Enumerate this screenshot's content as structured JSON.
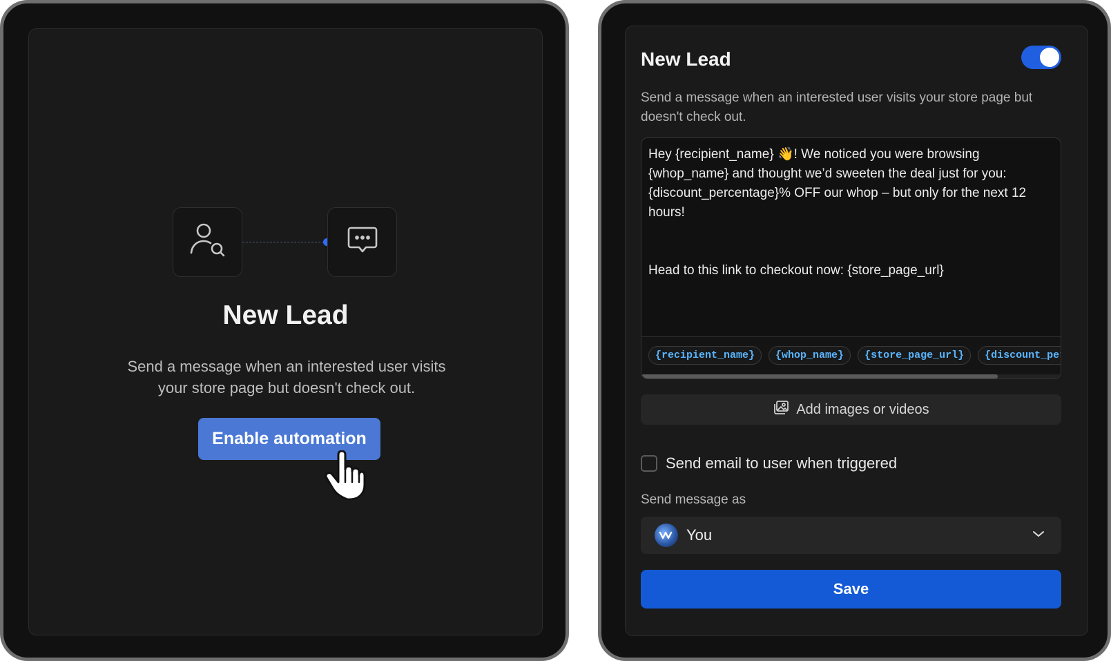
{
  "left": {
    "title": "New Lead",
    "description": "Send a message when an interested user visits your store page but doesn't check out.",
    "enable_button": "Enable automation"
  },
  "right": {
    "title": "New Lead",
    "toggle_on": true,
    "description": "Send a message when an interested user visits your store page but doesn't check out.",
    "message": "Hey {recipient_name} 👋! We noticed you were browsing {whop_name} and thought we’d sweeten the deal just for you: {discount_percentage}% OFF our whop – but only for the next 12 hours!\n\n\nHead to this link to checkout now: {store_page_url}",
    "tags": [
      "{recipient_name}",
      "{whop_name}",
      "{store_page_url}",
      "{discount_percentage}"
    ],
    "add_media": "Add images or videos",
    "email_label": "Send email to user when triggered",
    "send_as_label": "Send message as",
    "send_as_value": "You",
    "save_button": "Save"
  },
  "colors": {
    "accent": "#145ad6",
    "enable_button": "#4a78d4",
    "tag_text": "#5ab5ff"
  }
}
